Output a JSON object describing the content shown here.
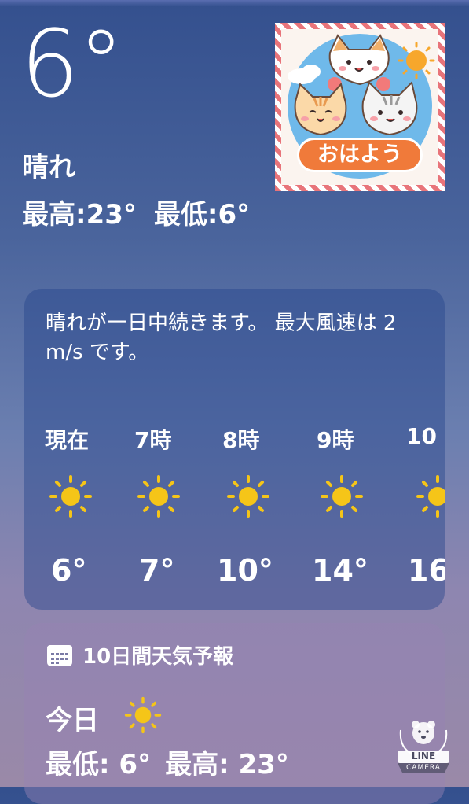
{
  "current": {
    "temperature": "6°",
    "condition": "晴れ",
    "high": "最高:23°",
    "low": "最低:6°"
  },
  "sticker": {
    "text": "おはよう"
  },
  "hourly": {
    "summary": "晴れが一日中続きます。 最大風速は 2 m/s です。",
    "items": [
      {
        "time": "現在",
        "icon": "sun-icon",
        "temp": "6°"
      },
      {
        "time": "7時",
        "icon": "sun-icon",
        "temp": "7°"
      },
      {
        "time": "8時",
        "icon": "sun-icon",
        "temp": "10°"
      },
      {
        "time": "9時",
        "icon": "sun-icon",
        "temp": "14°"
      },
      {
        "time": "10",
        "icon": "sun-icon",
        "temp": "16"
      }
    ]
  },
  "daily": {
    "header": "10日間天気予報",
    "header_icon": "calendar-icon",
    "today_label": "今日",
    "today_icon": "sun-icon",
    "today_low": "最低: 6°",
    "today_high": "最高: 23°"
  },
  "watermark": {
    "line": "LINE",
    "camera": "CAMERA"
  },
  "colors": {
    "sun": "#f5c518",
    "sticker_orange": "#f07a3a"
  }
}
